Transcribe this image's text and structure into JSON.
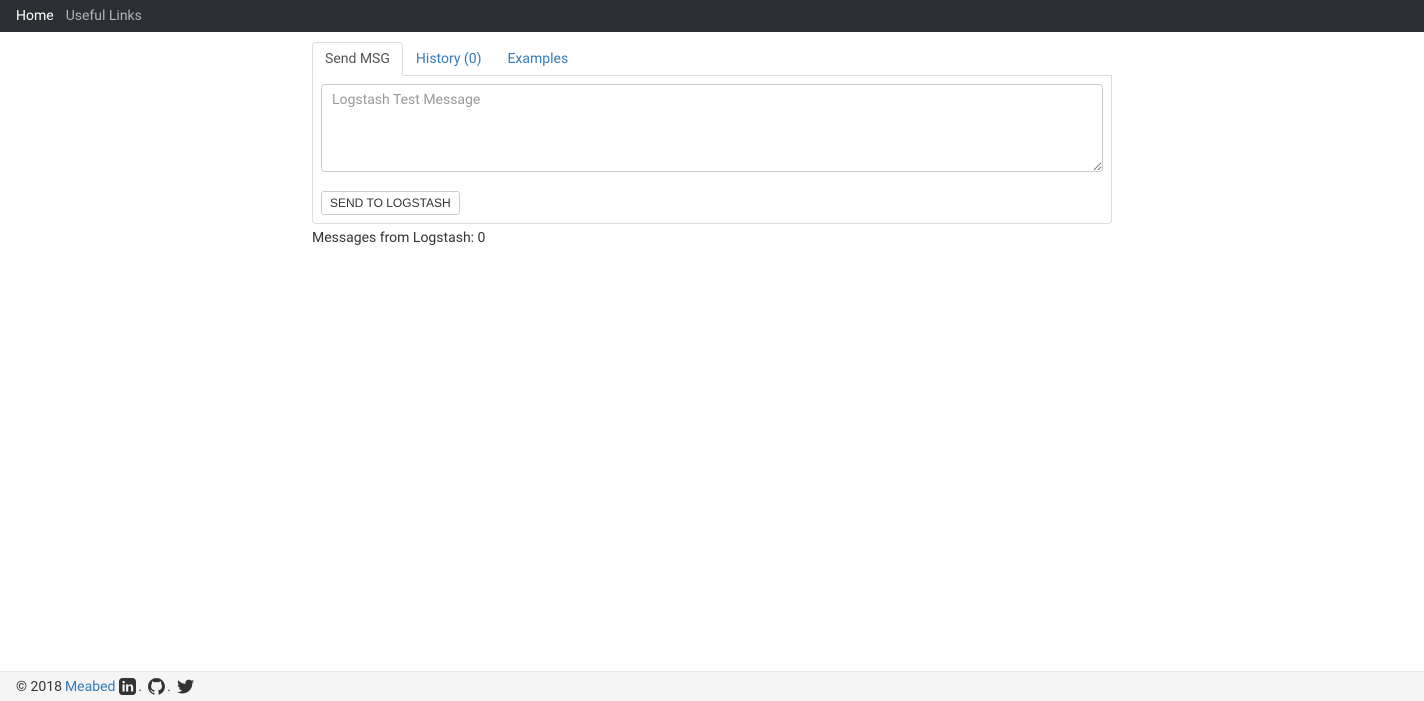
{
  "nav": {
    "home": "Home",
    "useful_links": "Useful Links"
  },
  "tabs": {
    "send_msg": "Send MSG",
    "history": "History (0)",
    "examples": "Examples"
  },
  "textarea": {
    "placeholder": "Logstash Test Message",
    "value": ""
  },
  "buttons": {
    "send": "SEND TO LOGSTASH"
  },
  "messages_line": "Messages from Logstash: 0",
  "footer": {
    "copyright": "© 2018",
    "author": "Meabed",
    "dot": "."
  }
}
